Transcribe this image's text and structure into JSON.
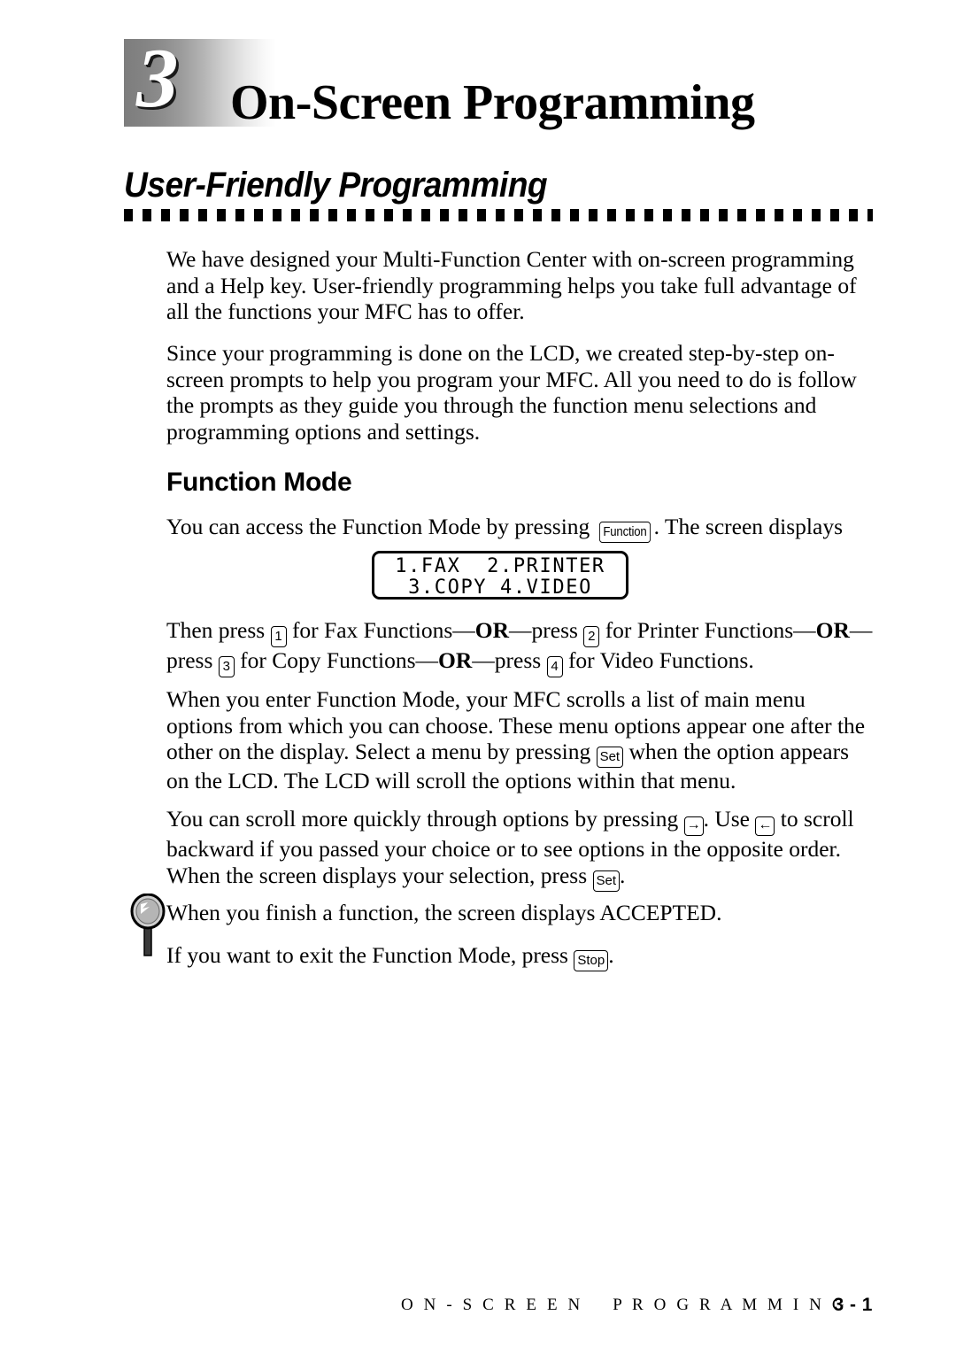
{
  "chapter": {
    "number": "3",
    "title": "On-Screen Programming"
  },
  "section": {
    "heading": "User-Friendly Programming"
  },
  "paragraphs": {
    "intro_1": "We have designed your Multi-Function Center with on-screen programming and a Help key. User-friendly programming helps you take full advantage of all the functions your MFC has to offer.",
    "intro_2": "Since your programming is done on the LCD, we created step-by-step on-screen prompts to help you program your MFC. All you need to do is follow the prompts as they guide you through the function menu selections and programming options and settings."
  },
  "subsection": {
    "heading": "Function Mode",
    "access_text_before": "You can access the Function Mode by pressing ",
    "access_text_after": ". The screen displays",
    "press_line_1_a": "Then press ",
    "press_line_1_b": " for Fax Functions—",
    "press_line_1_or": "OR",
    "press_line_1_c": "—press ",
    "press_line_1_d": " for Printer Functions",
    "press_line_2_a": "—",
    "press_line_2_or1": "OR",
    "press_line_2_b": "—press ",
    "press_line_2_c": " for Copy Functions—",
    "press_line_2_or2": "OR",
    "press_line_2_d": "—press ",
    "press_line_2_e": " for Video Functions.",
    "scroll_para_a": "When you enter Function Mode, your MFC scrolls a list of main menu options from which you can choose. These menu options appear one after the other on the display. Select a menu by pressing ",
    "scroll_para_b": " when the option appears on the LCD. The LCD will scroll the options within that menu.",
    "quick_scroll_a": "You can scroll more quickly through options by pressing ",
    "quick_scroll_b": ". Use ",
    "quick_scroll_c": " to scroll backward if you passed your choice or to see options in the opposite order. When the screen displays your selection, press ",
    "quick_scroll_d": ".",
    "note_1": "When you finish a function, the screen displays ACCEPTED.",
    "note_2_a": "If you want to exit the Function Mode, press ",
    "note_2_b": "."
  },
  "keys": {
    "function": "Function",
    "set": "Set",
    "stop": "Stop",
    "one": "1",
    "two": "2",
    "three": "3",
    "four": "4",
    "arrow_right": "→",
    "arrow_left": "←"
  },
  "lcd": {
    "line_1": "1.FAX  2.PRINTER",
    "line_2": "3.COPY 4.VIDEO"
  },
  "footer": {
    "title": "O N - S C R E E N    P R O G R A M M I N G",
    "page_number": "3 - 1"
  },
  "colors": {
    "text": "#000000",
    "page_background": "#ffffff",
    "gradient_dark": "#7d7d7d",
    "gradient_light": "#ffffff",
    "icon_gray": "#b0b0b0"
  }
}
